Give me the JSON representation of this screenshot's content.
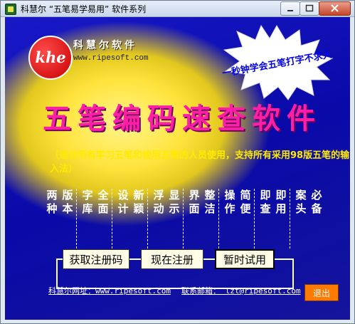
{
  "window": {
    "title": "科慧尔 “五笔易学易用” 软件系列"
  },
  "logo": {
    "mark": "khe",
    "brand": "科慧尔软件",
    "url": "www.ripesoft.com"
  },
  "banner": {
    "line1": "一秒钟学会",
    "line2": "五笔打字不求人"
  },
  "main": {
    "title": "五笔编码速查软件",
    "subtitle": "（适合所有学习五笔和使用五笔的人员使用，支持所有采用98版五笔的输入法）"
  },
  "features": [
    {
      "a": "两种",
      "b": "版本"
    },
    {
      "a": "字库",
      "b": "全面"
    },
    {
      "a": "设计",
      "b": "新颖"
    },
    {
      "a": "浮动",
      "b": "显示"
    },
    {
      "a": "界面",
      "b": "整洁"
    },
    {
      "a": "操作",
      "b": "简便"
    },
    {
      "a": "即查",
      "b": "即用"
    },
    {
      "a": "案头",
      "b": "必备"
    }
  ],
  "buttons": {
    "get_code": "获取注册码",
    "register_now": "现在注册",
    "trial": "暂时试用",
    "exit": "退出"
  },
  "footer": {
    "website": "科慧尔网址：www.ripesoft.com",
    "email": "联系邮箱： lzt@ripesoft.com"
  },
  "colors": {
    "client_blue": "#1414b8",
    "highlight_yellow": "#ffe33c",
    "title_pink": "#ff1fa6",
    "exit_orange": "#ff7a00"
  }
}
